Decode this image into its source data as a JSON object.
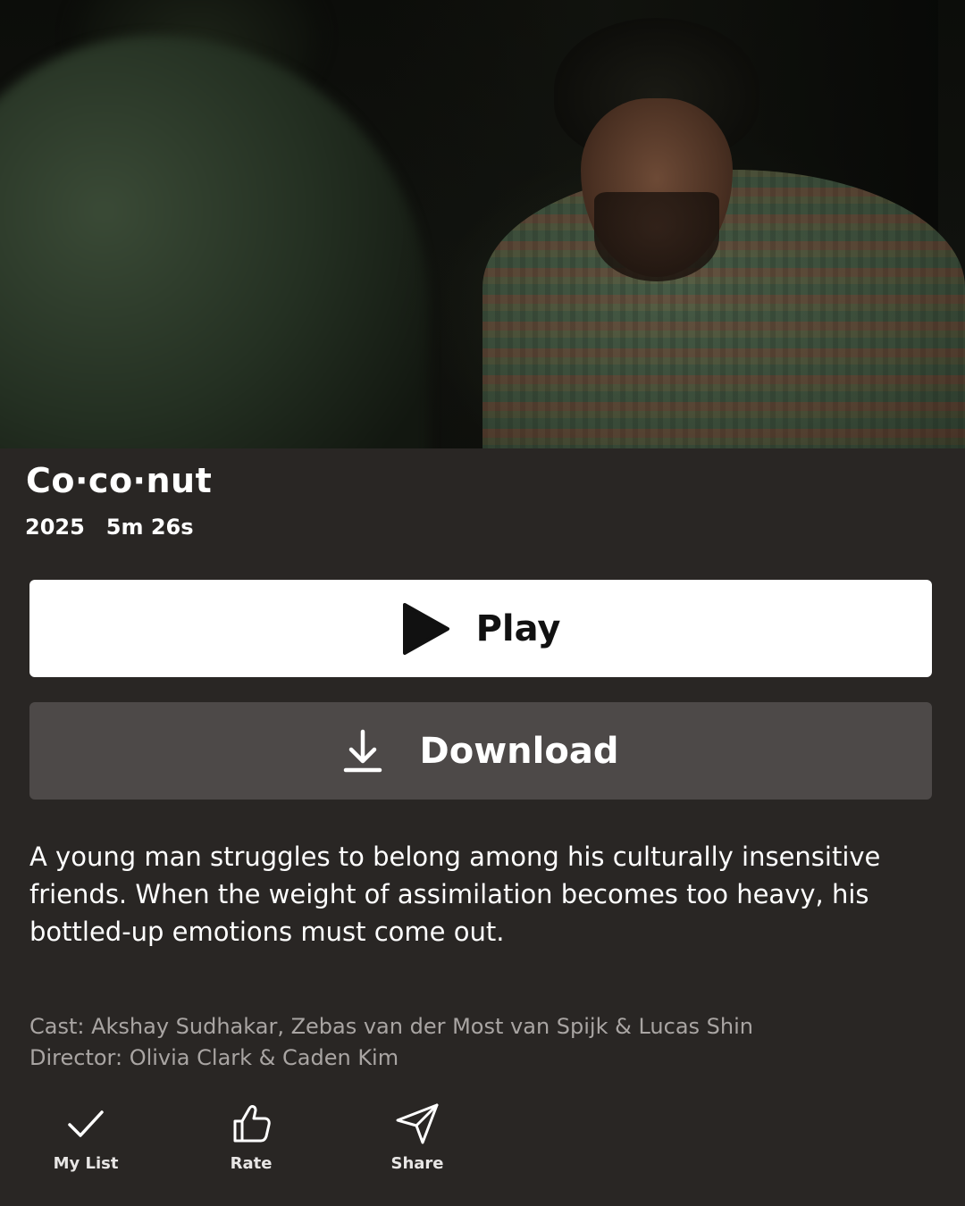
{
  "hero": {
    "image_alt": "still"
  },
  "title": {
    "text": "Co·co·nut",
    "year": "2025",
    "duration": "5m 26s"
  },
  "buttons": {
    "play_label": "Play",
    "download_label": "Download",
    "play_icon": "play-icon",
    "download_icon": "download-icon"
  },
  "synopsis": "A young man struggles to belong among his culturally insensitive friends. When the weight of assimilation becomes too heavy, his bottled-up emotions must come out.",
  "credits": {
    "cast": "Cast: Akshay Sudhakar, Zebas van der Most van Spijk & Lucas Shin",
    "director": "Director: Olivia Clark & Caden Kim"
  },
  "actions": [
    {
      "label": "My List",
      "icon": "check-icon"
    },
    {
      "label": "Rate",
      "icon": "thumbs-up-icon"
    },
    {
      "label": "Share",
      "icon": "send-icon"
    }
  ],
  "colors": {
    "background": "#292624",
    "play_button_bg": "#ffffff",
    "download_button_bg": "#4d4948",
    "credits_text": "#a9a5a3"
  }
}
